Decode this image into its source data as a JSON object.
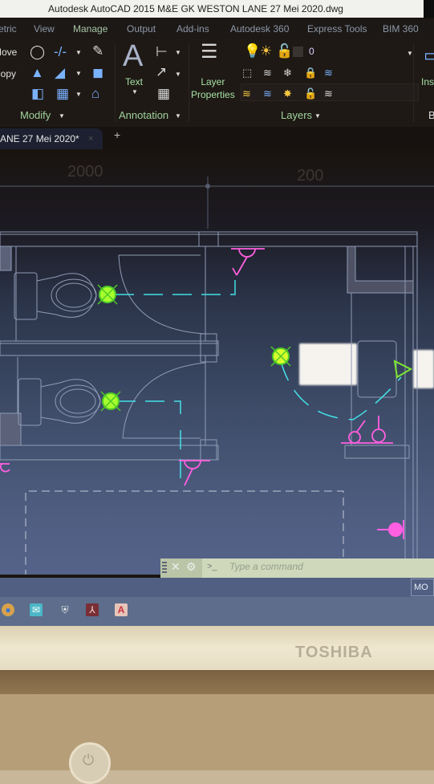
{
  "window": {
    "title": "Autodesk AutoCAD 2015     M&E GK WESTON LANE 27 Mei 2020.dwg"
  },
  "menu": {
    "tabs": [
      {
        "label": "etric"
      },
      {
        "label": "View"
      },
      {
        "label": "Manage",
        "active": true
      },
      {
        "label": "Output"
      },
      {
        "label": "Add-ins"
      },
      {
        "label": "Autodesk 360"
      },
      {
        "label": "Express Tools"
      },
      {
        "label": "BIM 360"
      }
    ]
  },
  "ribbon": {
    "modify": {
      "label": "Modify",
      "move_label": "Move",
      "copy_label": "Copy",
      "tools": [
        "rotate-icon",
        "trim-icon",
        "erase-icon",
        "mirror-icon",
        "fillet-icon",
        "explode-icon",
        "stretch-icon",
        "array-icon",
        "offset-icon"
      ]
    },
    "annotation": {
      "label": "Annotation",
      "text_label": "Text",
      "text_glyph": "A",
      "tools": [
        "dimension-icon",
        "leader-icon",
        "table-icon"
      ]
    },
    "layers": {
      "label": "Layers",
      "properties_label": "Layer\nProperties",
      "current_layer": "0",
      "state_icons": [
        "bulb-on-icon",
        "sun-icon",
        "unlock-icon",
        "color-swatch-icon"
      ],
      "tools_row1": [
        "layer-off-icon",
        "make-current-icon",
        "freeze-icon",
        "lock-icon",
        "match-layer-icon"
      ],
      "tools_row2": [
        "isolate-icon",
        "layer-previous-icon",
        "thaw-all-icon",
        "unlock-layer-icon",
        "layer-walk-icon"
      ]
    },
    "block": {
      "insert_label": "Ins",
      "label": "B"
    }
  },
  "tabs": {
    "file_tab_label": "ANE 27 Mei 2020*",
    "close_glyph": "×",
    "new_tab_glyph": "+"
  },
  "drawing": {
    "dimension_text_left": "2000",
    "dimension_text_right": "200",
    "colors": {
      "walls": "#8f9bb5",
      "lights": "#a6ff2c",
      "wiring": "#44e0e8",
      "switches": "#ff5fe0",
      "background": "#3a4763"
    }
  },
  "command_line": {
    "close_glyph": "✕",
    "settings_glyph": "🔧",
    "prompt_glyph": ">_",
    "placeholder": "Type  a command"
  },
  "status": {
    "model_label": "MO"
  },
  "taskbar": {
    "apps": [
      {
        "name": "chrome",
        "glyph": "●"
      },
      {
        "name": "mail",
        "glyph": "✉"
      },
      {
        "name": "security",
        "glyph": "⛨"
      },
      {
        "name": "acrobat",
        "glyph": "⅄"
      },
      {
        "name": "autocad",
        "glyph": "A"
      }
    ]
  },
  "hardware": {
    "brand": "TOSHIBA",
    "power_glyph": "⏻"
  }
}
